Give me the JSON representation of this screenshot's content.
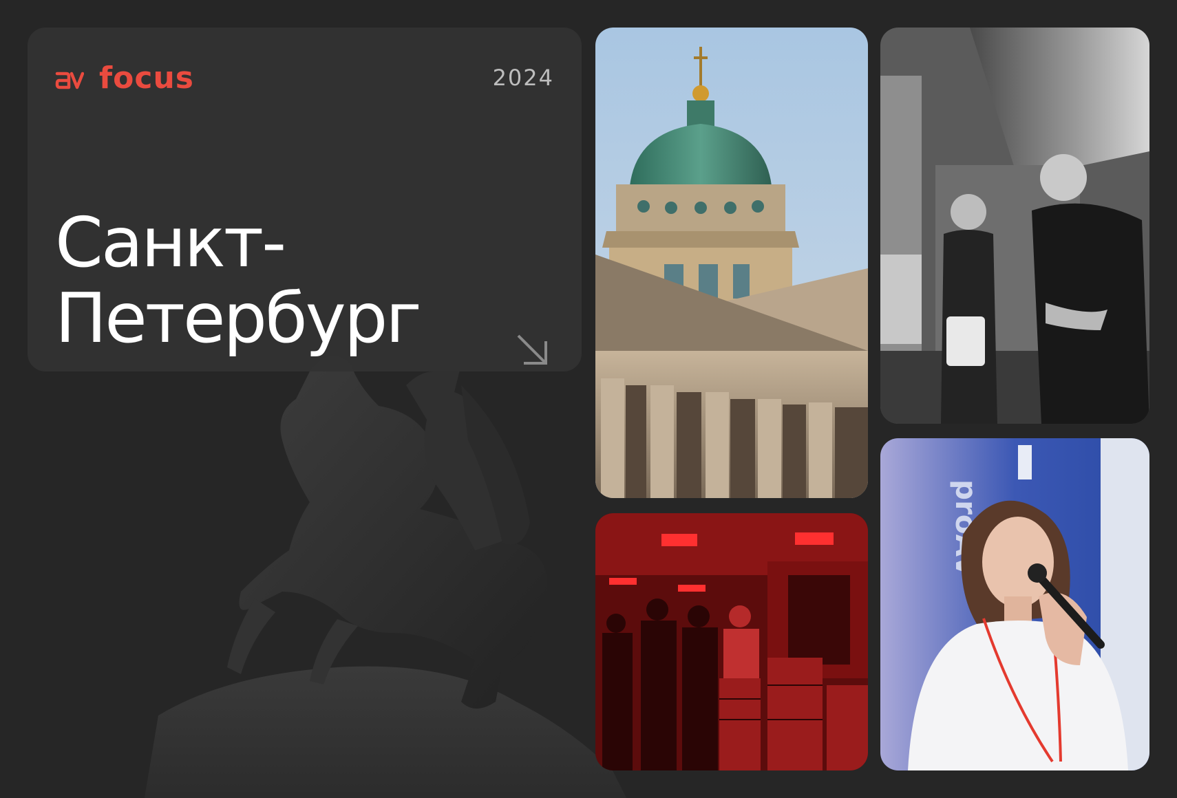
{
  "brand": {
    "logo_mark": "av",
    "logo_text": "focus",
    "accent_color": "#ea4b3f"
  },
  "year": "2024",
  "city": {
    "line1": "Санкт-",
    "line2": "Петербург"
  },
  "icons": {
    "arrow": "arrow-down-right-icon"
  },
  "photos": [
    {
      "name": "kazan-cathedral-photo"
    },
    {
      "name": "exhibition-conversation-photo"
    },
    {
      "name": "showroom-red-photo"
    },
    {
      "name": "speaker-microphone-photo",
      "banner_text": "proAV"
    }
  ]
}
